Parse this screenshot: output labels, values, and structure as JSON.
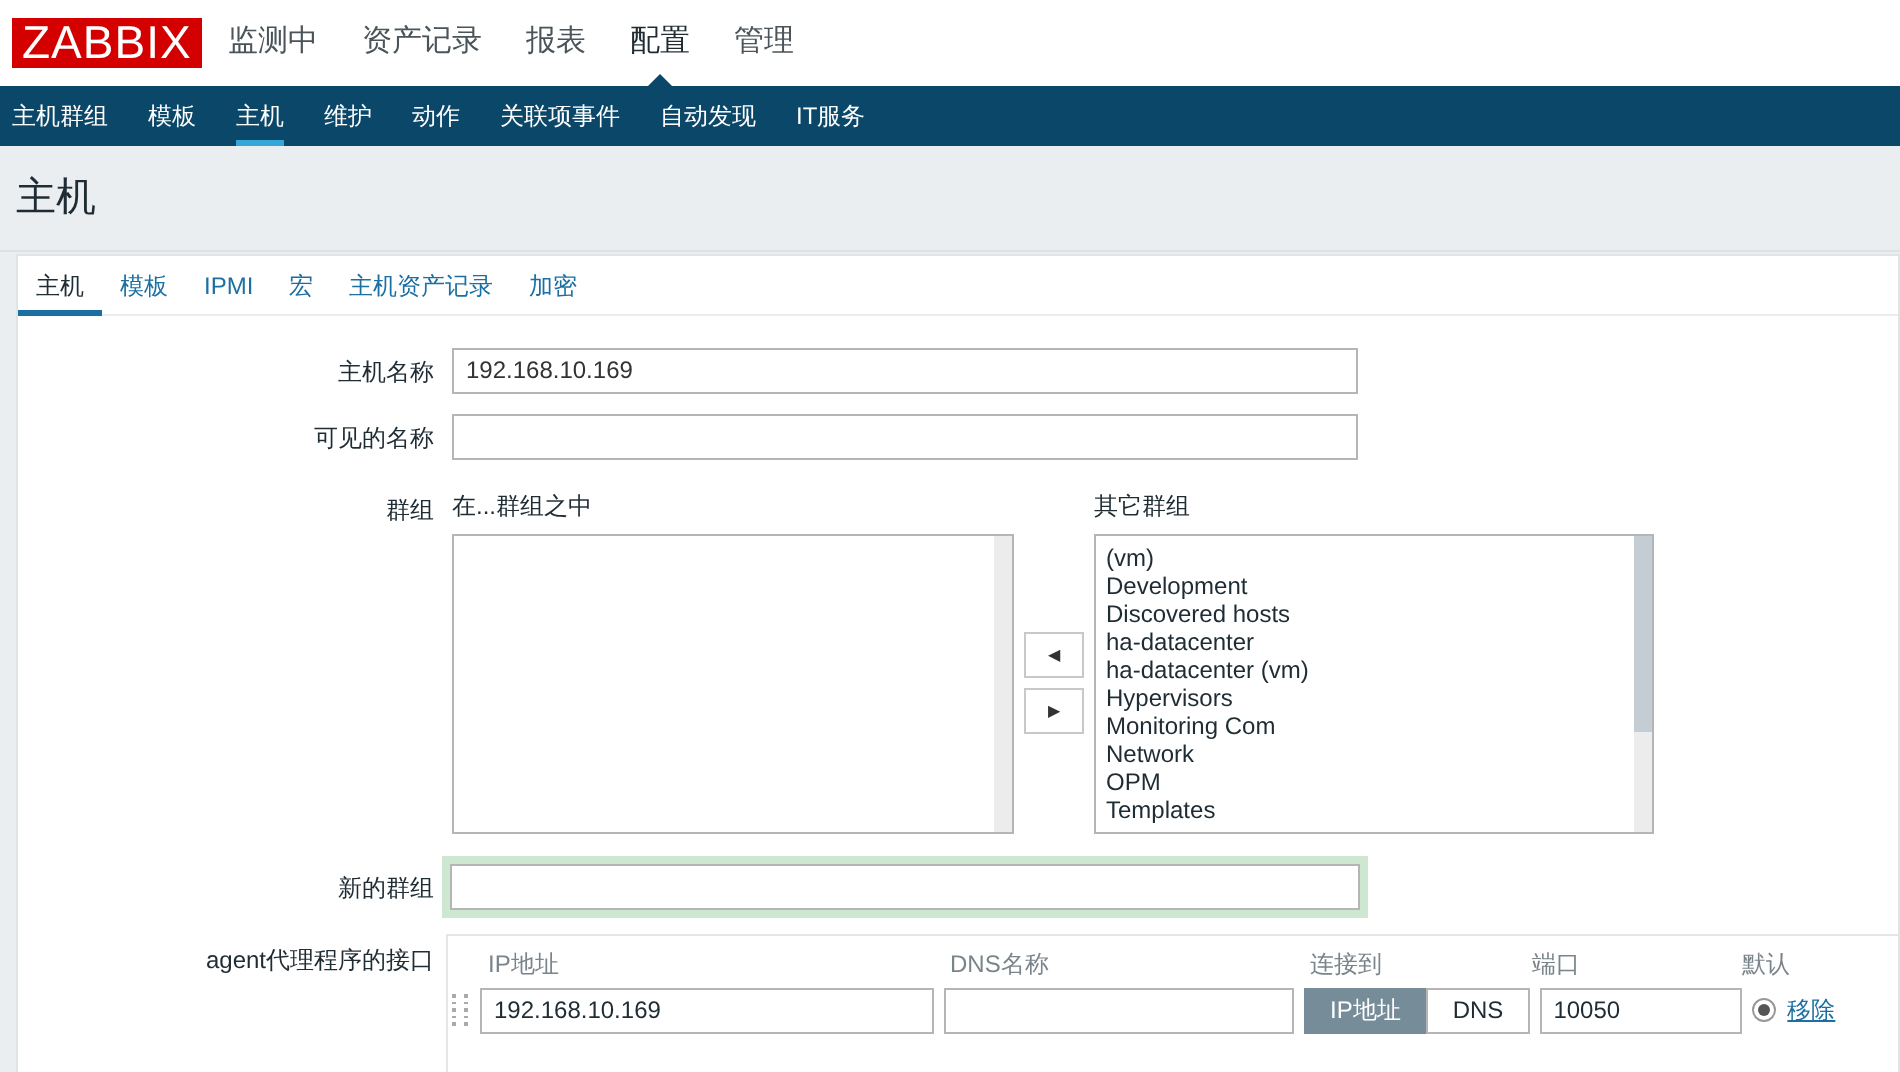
{
  "logo": "ZABBIX",
  "main_menu": [
    {
      "label": "监测中",
      "selected": false
    },
    {
      "label": "资产记录",
      "selected": false
    },
    {
      "label": "报表",
      "selected": false
    },
    {
      "label": "配置",
      "selected": true
    },
    {
      "label": "管理",
      "selected": false
    }
  ],
  "sub_menu": [
    {
      "label": "主机群组",
      "selected": false
    },
    {
      "label": "模板",
      "selected": false
    },
    {
      "label": "主机",
      "selected": true
    },
    {
      "label": "维护",
      "selected": false
    },
    {
      "label": "动作",
      "selected": false
    },
    {
      "label": "关联项事件",
      "selected": false
    },
    {
      "label": "自动发现",
      "selected": false
    },
    {
      "label": "IT服务",
      "selected": false
    }
  ],
  "page_title": "主机",
  "tabs": [
    {
      "label": "主机",
      "selected": true
    },
    {
      "label": "模板",
      "selected": false
    },
    {
      "label": "IPMI",
      "selected": false
    },
    {
      "label": "宏",
      "selected": false
    },
    {
      "label": "主机资产记录",
      "selected": false
    },
    {
      "label": "加密",
      "selected": false
    }
  ],
  "form": {
    "host_name": {
      "label": "主机名称",
      "value": "192.168.10.169"
    },
    "visible_name": {
      "label": "可见的名称"
    },
    "groups": {
      "label": "群组",
      "in_groups_label": "在...群组之中",
      "other_groups_label": "其它群组",
      "move_left": "◀",
      "move_right": "▶",
      "other_groups": [
        "(vm)",
        "Development",
        "Discovered hosts",
        "ha-datacenter",
        "ha-datacenter (vm)",
        "Hypervisors",
        "Monitoring Com",
        "Network",
        "OPM",
        "Templates"
      ]
    },
    "new_group": {
      "label": "新的群组"
    },
    "agent_interfaces": {
      "label": "agent代理程序的接口",
      "columns": [
        "IP地址",
        "DNS名称",
        "连接到",
        "端口",
        "默认"
      ],
      "rows": [
        {
          "ip": "192.168.10.169",
          "connect": [
            {
              "label": "IP地址",
              "selected": true
            },
            {
              "label": "DNS",
              "selected": false
            }
          ],
          "port": "10050",
          "default": true,
          "remove": "移除"
        }
      ]
    }
  }
}
